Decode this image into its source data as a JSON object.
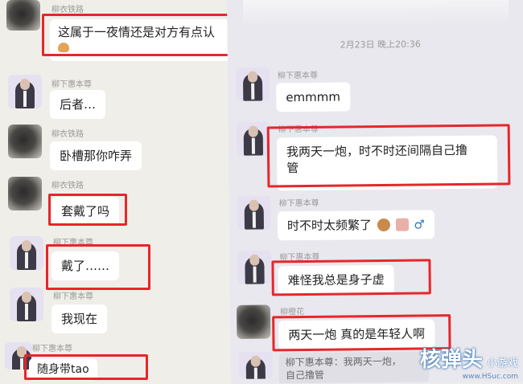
{
  "left": {
    "messages": [
      {
        "name": "柳衣铁路",
        "text": "这属于一夜情还是对方有点认"
      },
      {
        "name": "柳下惠本尊",
        "text": "后者…"
      },
      {
        "name": "柳衣铁路",
        "text": "卧槽那你咋弄"
      },
      {
        "name": "柳衣铁路",
        "text": "套戴了吗"
      },
      {
        "name": "柳下惠本尊",
        "text": "戴了……"
      },
      {
        "name": "柳下惠本尊",
        "text": "我现在"
      },
      {
        "name": "柳下惠本尊",
        "text": "随身带tao"
      }
    ]
  },
  "right": {
    "timestamp": "2月23日 晚上20:36",
    "messages": [
      {
        "name": "柳下惠本尊",
        "text": "emmmm"
      },
      {
        "name": "柳下惠本尊",
        "text_line1": "我两天一炮，时不时还间隔自己撸",
        "text_line2": "管"
      },
      {
        "name": "柳下惠本尊",
        "text": "时不时太频繁了"
      },
      {
        "name": "柳下惠本尊",
        "text": "难怪我总是身子虚"
      },
      {
        "name": "柳橙花",
        "text": "两天一炮 真的是年轻人啊"
      },
      {
        "name": "柳下惠本尊",
        "quote_line1": "柳下惠本尊：我两天一炮，",
        "quote_line2": "自己撸管"
      }
    ]
  },
  "watermark": {
    "brand": "核弹头",
    "sub": "小游戏",
    "url": "www.HSuc.com"
  },
  "colors": {
    "highlight": "#e7262a",
    "bubble": "#ffffff",
    "name": "#9a9a9a",
    "emoji_face": "#c98a4a",
    "emoji_block": "#e8b1a8",
    "male_symbol": "#2a7ab8"
  },
  "icons": [
    "tiger-emoji-icon",
    "person-emoji-icon",
    "block-emoji-icon",
    "male-symbol-icon"
  ]
}
